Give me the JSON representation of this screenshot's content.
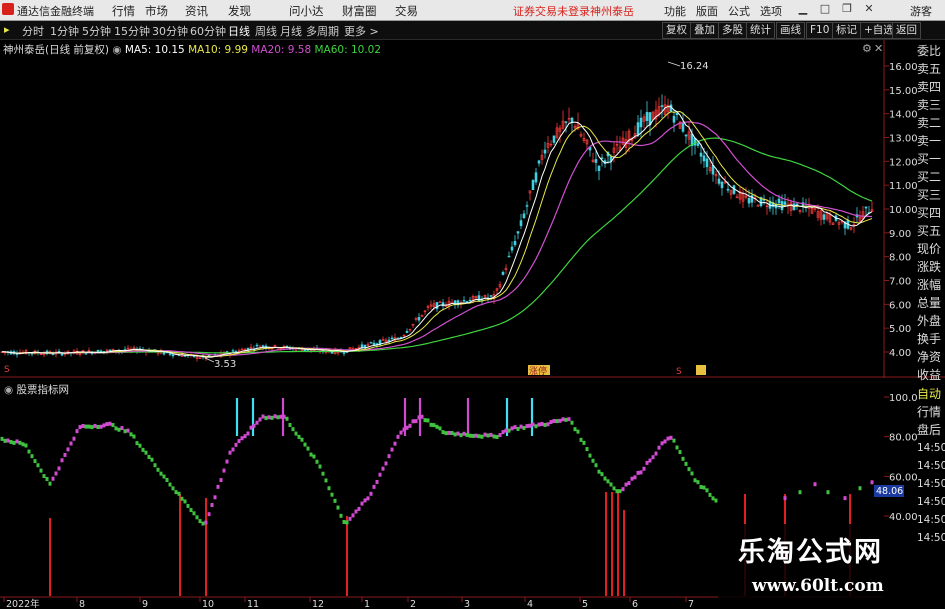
{
  "menubar": {
    "app_name": "通达信金融终端",
    "menus": [
      "行情",
      "市场",
      "资讯",
      "发现",
      "问小达",
      "财富圈",
      "交易"
    ],
    "warning": "证券交易未登录",
    "stock_name": "神州泰岳",
    "right_buttons": [
      "功能",
      "版面",
      "公式",
      "选项"
    ],
    "login": "游客"
  },
  "periodbar": {
    "periods": [
      "分时",
      "1分钟",
      "5分钟",
      "15分钟",
      "30分钟",
      "60分钟",
      "日线",
      "周线",
      "月线",
      "多周期",
      "更多 >"
    ],
    "active": "日线",
    "tools": [
      "复权",
      "叠加",
      "多股",
      "统计",
      "画线",
      "F10",
      "标记",
      "+自选",
      "返回"
    ]
  },
  "main_chart": {
    "title": "神州泰岳(日线 前复权)",
    "ma": [
      {
        "label": "MA5: 10.15",
        "color": "#ffffff"
      },
      {
        "label": "MA10: 9.99",
        "color": "#e8e84a"
      },
      {
        "label": "MA20: 9.58",
        "color": "#d050d0"
      },
      {
        "label": "MA60: 10.02",
        "color": "#3fd43f"
      }
    ],
    "price_axis": [
      "16.00",
      "15.00",
      "14.00",
      "13.00",
      "12.00",
      "11.00",
      "10.00",
      "9.00",
      "8.00",
      "7.00",
      "6.00",
      "5.00",
      "4.00"
    ],
    "high_label": "16.24",
    "low_label": "3.53",
    "markers": [
      "涨停",
      "S"
    ]
  },
  "sub_chart": {
    "title": "股票指标网",
    "axis": [
      "100.0",
      "80.00",
      "60.00",
      "40.00"
    ],
    "last_value": "48.06"
  },
  "time_axis": [
    "2022年",
    "8",
    "9",
    "10",
    "11",
    "12",
    "1",
    "2",
    "3",
    "4",
    "5",
    "6",
    "7"
  ],
  "side_panel": {
    "items": [
      "委比",
      "卖五",
      "卖四",
      "卖三",
      "卖二",
      "卖一",
      "买一",
      "买二",
      "买三",
      "买四",
      "买五",
      "现价",
      "涨跌",
      "涨幅",
      "总量",
      "外盘",
      "换手",
      "净资",
      "收益"
    ],
    "lower_items": [
      "自动",
      "行情",
      "盘后",
      "14:50",
      "14:50",
      "14:50",
      "14:50",
      "14:50",
      "14:50"
    ]
  },
  "watermark": {
    "line1": "乐淘公式网",
    "line2": "www.60lt.com"
  }
}
